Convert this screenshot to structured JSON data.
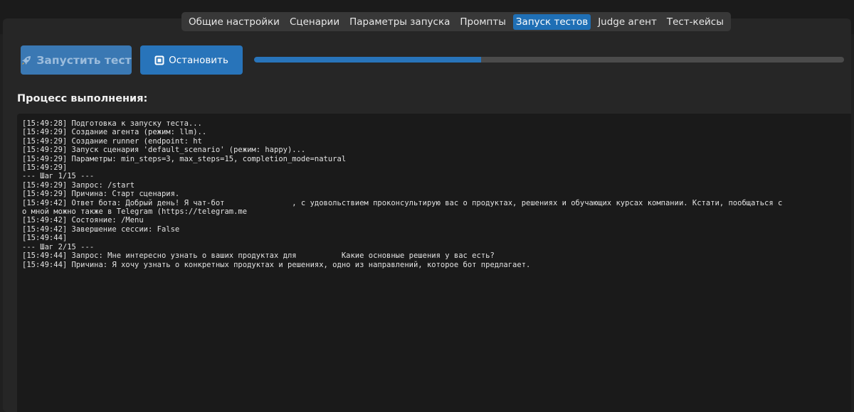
{
  "tabs": [
    {
      "label": "Общие настройки",
      "active": false
    },
    {
      "label": "Сценарии",
      "active": false
    },
    {
      "label": "Параметры запуска",
      "active": false
    },
    {
      "label": "Промпты",
      "active": false
    },
    {
      "label": "Запуск тестов",
      "active": true
    },
    {
      "label": "Judge агент",
      "active": false
    },
    {
      "label": "Тест-кейсы",
      "active": false
    }
  ],
  "controls": {
    "run_label": "Запустить тест",
    "run_icon": "rocket-icon",
    "stop_label": "Остановить",
    "stop_icon": "stop-square-icon",
    "progress_fraction": 0.385
  },
  "process": {
    "title": "Процесс выполнения:",
    "log_lines": [
      "[15:49:28] Подготовка к запуску теста...",
      "[15:49:29] Создание агента (режим: llm)..",
      "[15:49:29] Создание runner (endpoint: ht",
      "[15:49:29] Запуск сценария 'default_scenario' (режим: happy)...",
      "[15:49:29] Параметры: min_steps=3, max_steps=15, completion_mode=natural",
      "[15:49:29]",
      "--- Шаг 1/15 ---",
      "[15:49:29] Запрос: /start",
      "[15:49:29] Причина: Старт сценария.",
      "[15:49:42] Ответ бота: Добрый день! Я чат-бот               , с удовольствием проконсультирую вас о продуктах, решениях и обучающих курсах компании. Кстати, пообщаться с",
      "о мной можно также в Telegram (https://telegram.me",
      "[15:49:42] Состояние: /Menu",
      "[15:49:42] Завершение сессии: False",
      "[15:49:44]",
      "--- Шаг 2/15 ---",
      "[15:49:44] Запрос: Мне интересно узнать о ваших продуктах для          Какие основные решения у вас есть?",
      "[15:49:44] Причина: Я хочу узнать о конкретных продуктах и решениях, одно из направлений, которое бот предлагает."
    ]
  },
  "colors": {
    "accent": "#2874ba",
    "background": "#202020",
    "log_background": "#1a1a1a",
    "progress_track": "#4b4b4b"
  }
}
